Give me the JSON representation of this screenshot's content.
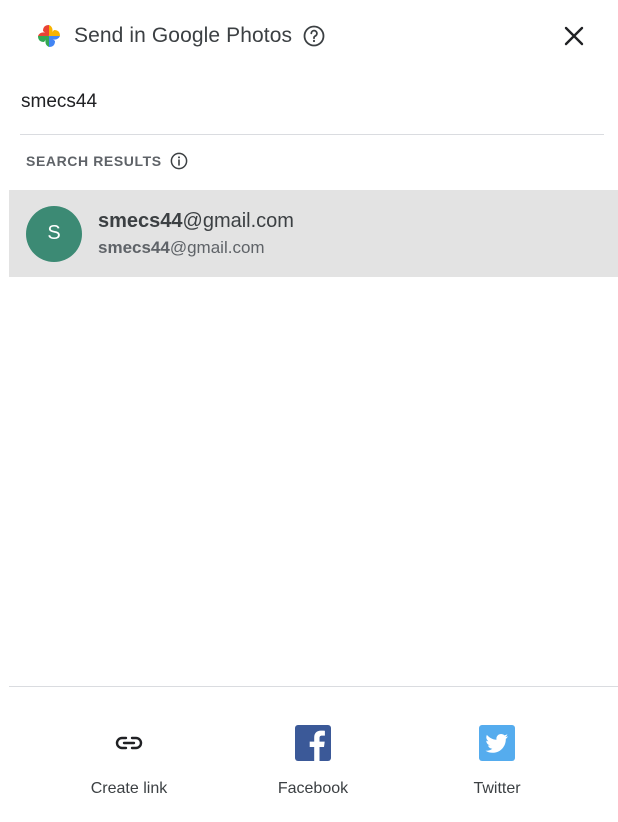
{
  "header": {
    "title": "Send in Google Photos"
  },
  "search": {
    "value": "smecs44"
  },
  "results": {
    "heading": "SEARCH RESULTS",
    "items": [
      {
        "avatar_letter": "S",
        "primary_bold": "smecs44",
        "primary_rest": "@gmail.com",
        "secondary_bold": "smecs44",
        "secondary_rest": "@gmail.com"
      }
    ]
  },
  "share": {
    "create_link": "Create link",
    "facebook": "Facebook",
    "twitter": "Twitter"
  },
  "colors": {
    "avatar_bg": "#3c8a74",
    "row_highlight": "#e3e3e3",
    "facebook_blue": "#3b5998",
    "twitter_blue": "#55acee"
  },
  "icons": {
    "logo": "google-photos-pinwheel-icon",
    "help": "help-circle-icon",
    "close": "close-icon",
    "info": "info-icon",
    "link": "link-icon",
    "facebook": "facebook-icon",
    "twitter": "twitter-icon"
  }
}
